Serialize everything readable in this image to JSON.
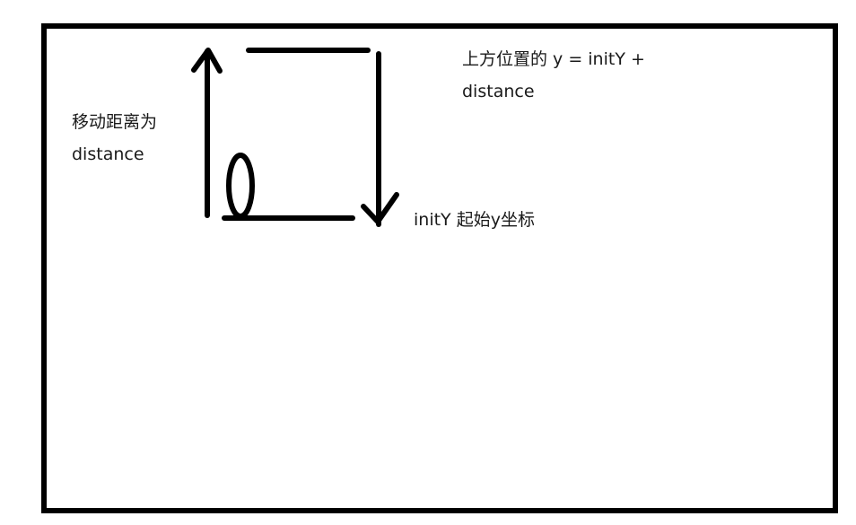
{
  "diagram": {
    "labels": {
      "move_distance_line1": "移动距离为",
      "move_distance_line2": "distance",
      "top_position_line1": "上方位置的 y = initY +",
      "top_position_line2": "distance",
      "init_y": "initY 起始y坐标"
    }
  }
}
